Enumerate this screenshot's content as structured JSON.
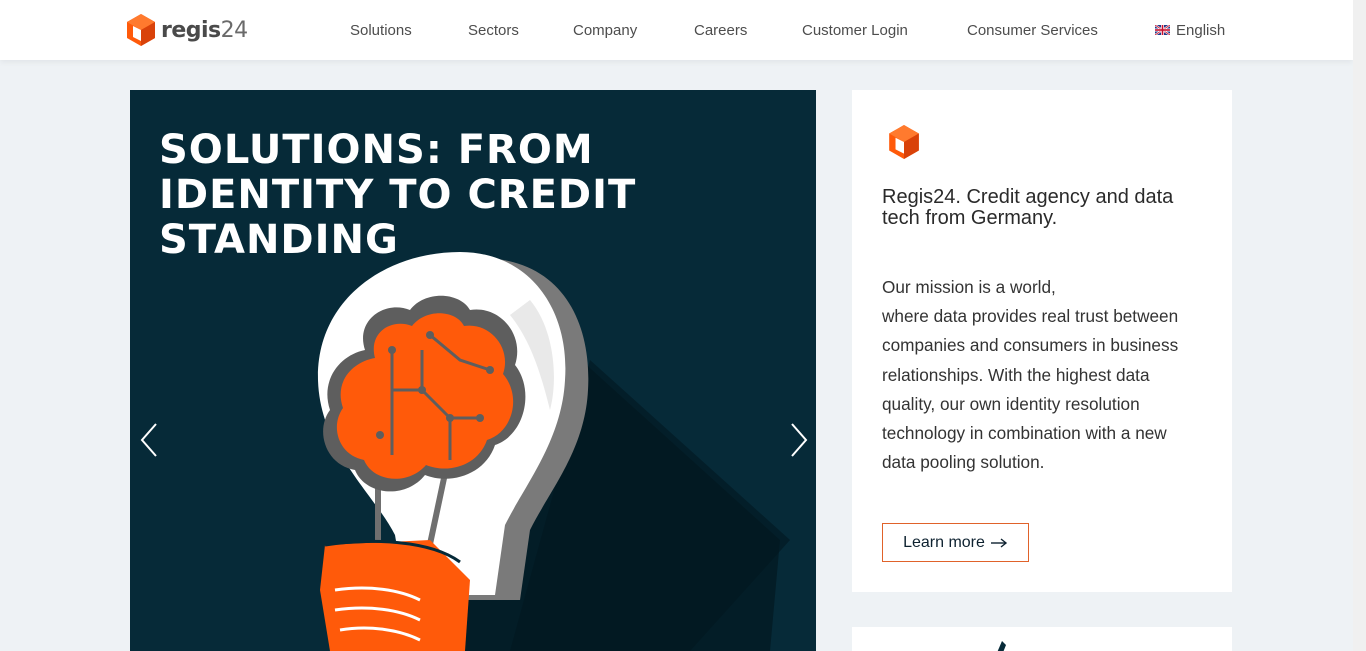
{
  "header": {
    "logo": {
      "word": "regis",
      "number": "24",
      "icon": "cube-logo-icon"
    },
    "nav": [
      {
        "label": "Solutions"
      },
      {
        "label": "Sectors"
      },
      {
        "label": "Company"
      },
      {
        "label": "Careers"
      },
      {
        "label": "Customer Login"
      },
      {
        "label": "Consumer Services"
      }
    ],
    "language": {
      "label": "English",
      "icon": "uk-flag-icon"
    }
  },
  "hero": {
    "title": "SOLUTIONS: FROM IDENTITY TO CREDIT STANDING",
    "prev_icon": "chevron-left-icon",
    "next_icon": "chevron-right-icon",
    "illustration": "lightbulb-brain-illustration"
  },
  "info_card": {
    "icon": "cube-logo-icon",
    "heading": "Regis24. Credit agency and data tech from Germany.",
    "body_lines": [
      "Our mission is a world,",
      "where data provides real trust between",
      "companies and consumers in business",
      "relationships. With the highest data",
      "quality, our own identity resolution",
      "technology in combination with a new",
      "data pooling solution."
    ],
    "button_label": "Learn more",
    "button_icon": "arrow-right-icon"
  },
  "colors": {
    "accent": "#ff5a0a",
    "hero_bg": "#062a38",
    "page_bg": "#eef2f5",
    "button_border": "#e0622a"
  }
}
